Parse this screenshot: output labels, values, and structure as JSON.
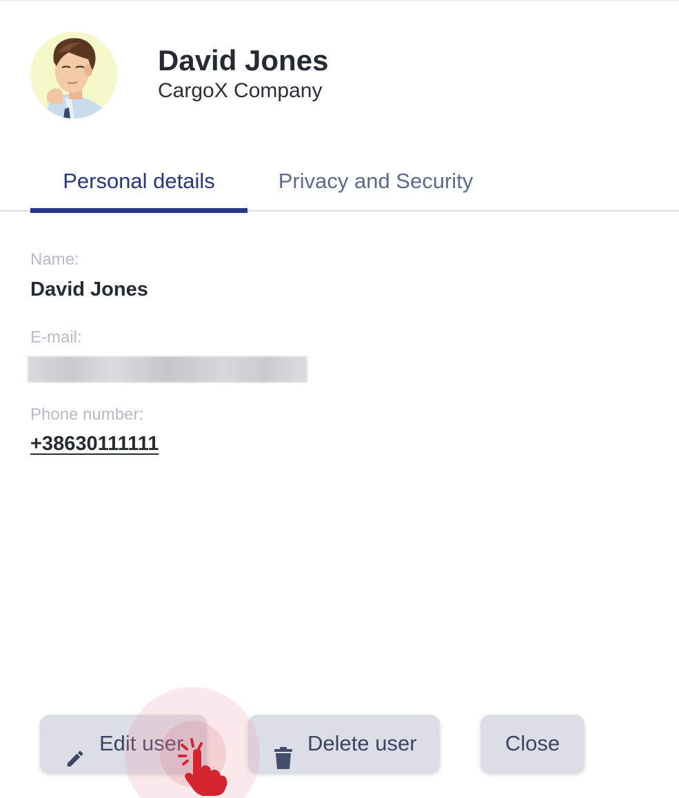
{
  "header": {
    "name": "David Jones",
    "company": "CargoX Company",
    "avatar_icon": "user-avatar-illustration"
  },
  "tabs": [
    {
      "label": "Personal details",
      "active": true
    },
    {
      "label": "Privacy and Security",
      "active": false
    }
  ],
  "fields": {
    "name_label": "Name:",
    "name_value": "David Jones",
    "email_label": "E-mail:",
    "email_value_redacted": true,
    "phone_label": "Phone number:",
    "phone_value": "+38630111111"
  },
  "buttons": {
    "edit_label": "Edit user",
    "edit_icon": "pencil-icon",
    "delete_label": "Delete user",
    "delete_icon": "trash-icon",
    "close_label": "Close"
  },
  "colors": {
    "accent": "#26378a",
    "button_bg": "#dcdee7",
    "click_indicator": "#d32530"
  }
}
